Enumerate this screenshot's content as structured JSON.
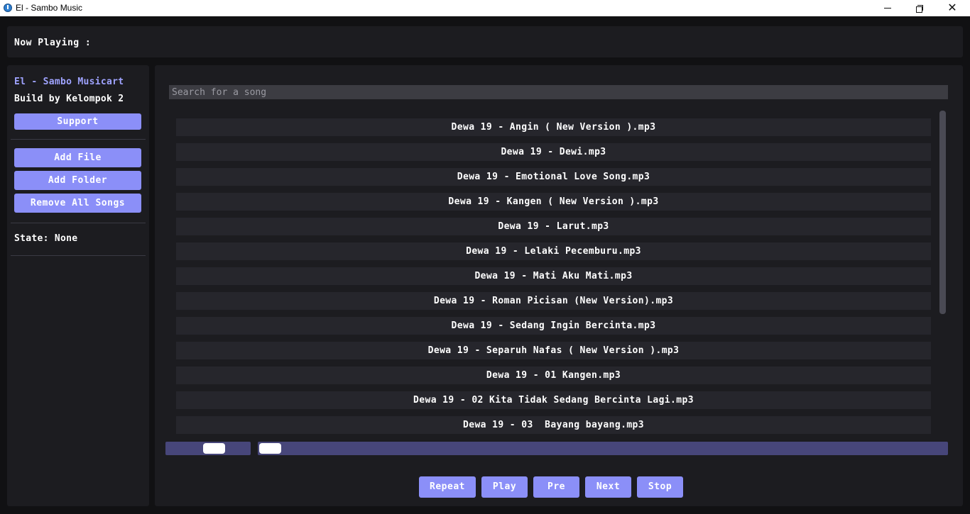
{
  "window": {
    "title": "El - Sambo Music",
    "icons": {
      "app": "app-icon",
      "minimize": "minimize-icon",
      "maximize": "maximize-icon",
      "close": "close-icon"
    },
    "close_glyph": "✕"
  },
  "now_playing": {
    "label": "Now Playing :"
  },
  "sidebar": {
    "app_title": "El - Sambo Musicart",
    "built_by": "Build by Kelompok 2",
    "support_label": "Support",
    "add_file_label": "Add File",
    "add_folder_label": "Add Folder",
    "remove_all_label": "Remove All Songs",
    "state_text": "State: None"
  },
  "search": {
    "placeholder": "Search for a song",
    "value": ""
  },
  "songs": [
    "Dewa 19 - Angin ( New Version ).mp3",
    "Dewa 19 - Dewi.mp3",
    "Dewa 19 - Emotional Love Song.mp3",
    "Dewa 19 - Kangen ( New Version ).mp3",
    "Dewa 19 - Larut.mp3",
    "Dewa 19 - Lelaki Pecemburu.mp3",
    "Dewa 19 - Mati Aku Mati.mp3",
    "Dewa 19 - Roman Picisan (New Version).mp3",
    "Dewa 19 - Sedang Ingin Bercinta.mp3",
    "Dewa 19 - Separuh Nafas ( New Version ).mp3",
    "Dewa 19 - 01 Kangen.mp3",
    "Dewa 19 - 02 Kita Tidak Sedang Bercinta Lagi.mp3",
    "Dewa 19 - 03  Bayang bayang.mp3"
  ],
  "volume": {
    "level": 0.6
  },
  "position": {
    "level": 0.0
  },
  "controls": {
    "repeat_label": "Repeat",
    "play_label": "Play",
    "pre_label": "Pre",
    "next_label": "Next",
    "stop_label": "Stop"
  },
  "colors": {
    "accent": "#8b8ff8",
    "title_accent": "#9fa3ff",
    "slider_track": "#47467a",
    "panel_bg": "#1c1c20",
    "row_bg": "#26262c"
  }
}
